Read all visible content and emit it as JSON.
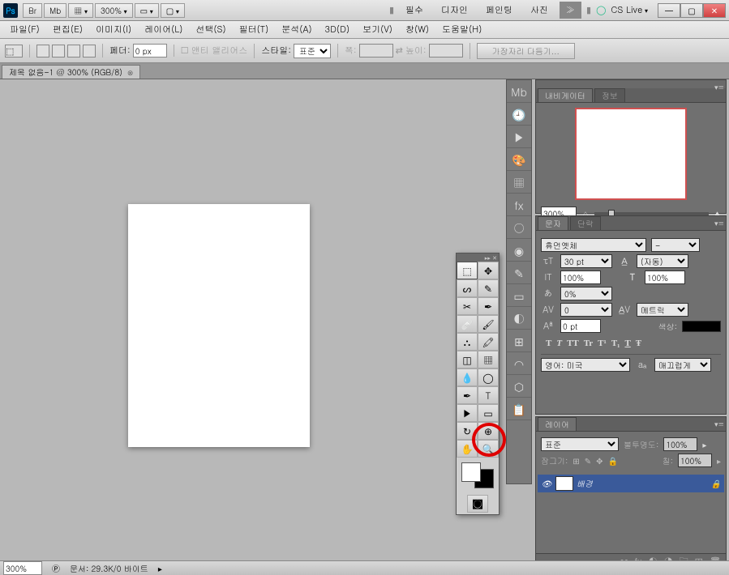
{
  "app": {
    "ps": "Ps",
    "br": "Br",
    "mb": "Mb",
    "zoom": "300%",
    "cslive": "CS Live"
  },
  "worktabs": {
    "t1": "필수",
    "t2": "디자인",
    "t3": "페인팅",
    "t4": "사진"
  },
  "menu": {
    "file": "파일(F)",
    "edit": "편집(E)",
    "image": "이미지(I)",
    "layer": "레이어(L)",
    "select": "선택(S)",
    "filter": "필터(T)",
    "analysis": "분석(A)",
    "threeD": "3D(D)",
    "view": "보기(V)",
    "window": "창(W)",
    "help": "도움말(H)"
  },
  "opt": {
    "feather_lbl": "페더:",
    "feather_val": "0 px",
    "antialias": "앤티 앨리어스",
    "style_lbl": "스타일:",
    "style_val": "표준",
    "width_lbl": "폭:",
    "height_lbl": "높이:",
    "refine": "가장자리 다듬기..."
  },
  "doc": {
    "title": "제목 없음-1 @ 300% (RGB/8)"
  },
  "nav": {
    "tab1": "내비게이터",
    "tab2": "정보",
    "zoom": "300%"
  },
  "char": {
    "tab1": "문자",
    "tab2": "단락",
    "font": "휴먼옛체",
    "style": "-",
    "size": "30 pt",
    "leading": "(자동)",
    "vscale": "100%",
    "hscale": "100%",
    "tracking": "0%",
    "kerning": "0",
    "metrics": "메트릭",
    "baseline": "0 pt",
    "color_lbl": "색상:",
    "lang": "영어: 미국",
    "aa": "매끄럽게"
  },
  "type": {
    "b": "T",
    "i": "T",
    "c1": "TT",
    "c2": "Tr",
    "c3": "T¹",
    "c4": "T₁",
    "u": "T",
    "s": "Ŧ"
  },
  "layers": {
    "tab": "레이어",
    "blend": "표준",
    "opacity_lbl": "불투명도:",
    "opacity": "100%",
    "lock_lbl": "잠그기:",
    "fill_lbl": "칠:",
    "fill": "100%",
    "bg": "배경"
  },
  "status": {
    "zoom": "300%",
    "doc": "문서: 29.3K/0 바이트"
  }
}
